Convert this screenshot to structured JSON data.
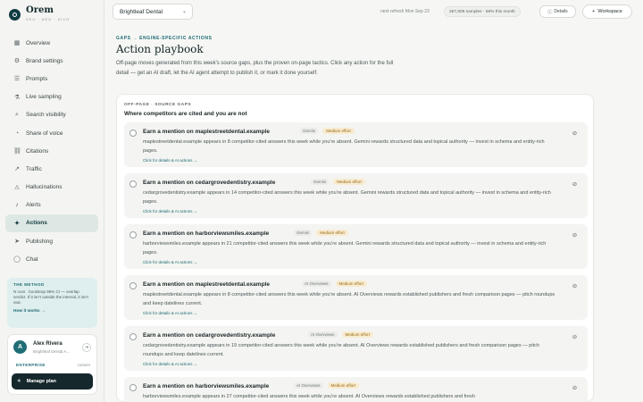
{
  "brand": {
    "name": "Orem",
    "tagline": "SEO · AEO · AIVO"
  },
  "sidebar": {
    "items": [
      {
        "label": "Overview",
        "icon": "grid-icon",
        "glyph": "▦"
      },
      {
        "label": "Brand settings",
        "icon": "gear-icon",
        "glyph": "⚙"
      },
      {
        "label": "Prompts",
        "icon": "list-icon",
        "glyph": "☰"
      },
      {
        "label": "Live sampling",
        "icon": "flask-icon",
        "glyph": "⚗"
      },
      {
        "label": "Search visibility",
        "icon": "search-icon",
        "glyph": "⌕"
      },
      {
        "label": "Share of voice",
        "icon": "pie-icon",
        "glyph": "◔"
      },
      {
        "label": "Citations",
        "icon": "link-icon",
        "glyph": "⛓"
      },
      {
        "label": "Traffic",
        "icon": "trend-icon",
        "glyph": "↗"
      },
      {
        "label": "Hallucinations",
        "icon": "warning-icon",
        "glyph": "⚠"
      },
      {
        "label": "Alerts",
        "icon": "bell-icon",
        "glyph": "♪"
      },
      {
        "label": "Actions",
        "icon": "bulb-icon",
        "glyph": "✦"
      },
      {
        "label": "Publishing",
        "icon": "send-icon",
        "glyph": "➤"
      },
      {
        "label": "Chat",
        "icon": "chat-icon",
        "glyph": "◯"
      }
    ],
    "active_index": 10,
    "method": {
      "title": "THE METHOD",
      "body": "N runs · bootstrap 95% CI — overlap verdict. If it isn't outside the interval, it isn't real.",
      "link": "How it works →"
    },
    "user": {
      "initial": "A",
      "name": "Alex Rivera",
      "org": "Brightleaf Dental A...",
      "plan": "ENTERPRISE",
      "plan_mode": "custom",
      "manage_label": "Manage plan"
    }
  },
  "topbar": {
    "brand_select": "Brightleaf Dental",
    "next_refresh": "next refresh Mon Sep 23",
    "samples": "287,509 samples · 58% this month",
    "details_label": "Details",
    "workspace_label": "Workspace"
  },
  "main": {
    "eyebrow": "GAPS → ENGINE-SPECIFIC ACTIONS",
    "title": "Action playbook",
    "description": "Off-page moves generated from this week's source gaps, plus the proven on-page tactics. Click any action for the full detail — get an AI draft, let the AI agent attempt to publish it, or mark it done yourself.",
    "section_eyebrow": "OFF-PAGE · SOURCE GAPS",
    "section_title": "Where competitors are cited and you are not",
    "actions": [
      {
        "title": "Earn a mention on maplestreetdental.example",
        "engine": "Gemini",
        "effort": "Medium effort",
        "body": "maplestreetdental.example appears in 8 competitor-cited answers this week while you're absent. Gemini rewards structured data and topical authority — invest in schema and entity-rich pages.",
        "link": "Click for details & AI actions →"
      },
      {
        "title": "Earn a mention on cedargrovedentistry.example",
        "engine": "Gemini",
        "effort": "Medium effort",
        "body": "cedargrovedentistry.example appears in 14 competitor-cited answers this week while you're absent. Gemini rewards structured data and topical authority — invest in schema and entity-rich pages.",
        "link": "Click for details & AI actions →"
      },
      {
        "title": "Earn a mention on harborviewsmiles.example",
        "engine": "Gemini",
        "effort": "Medium effort",
        "body": "harborviewsmiles.example appears in 21 competitor-cited answers this week while you're absent. Gemini rewards structured data and topical authority — invest in schema and entity-rich pages.",
        "link": "Click for details & AI actions →"
      },
      {
        "title": "Earn a mention on maplestreetdental.example",
        "engine": "AI Overviews",
        "effort": "Medium effort",
        "body": "maplestreetdental.example appears in 8 competitor-cited answers this week while you're absent. AI Overviews rewards established publishers and fresh comparison pages — pitch roundups and keep datelines current.",
        "link": "Click for details & AI actions →"
      },
      {
        "title": "Earn a mention on cedargrovedentistry.example",
        "engine": "AI Overviews",
        "effort": "Medium effort",
        "body": "cedargrovedentistry.example appears in 19 competitor-cited answers this week while you're absent. AI Overviews rewards established publishers and fresh comparison pages — pitch roundups and keep datelines current.",
        "link": "Click for details & AI actions →"
      },
      {
        "title": "Earn a mention on harborviewsmiles.example",
        "engine": "AI Overviews",
        "effort": "Medium effort",
        "body": "harborviewsmiles.example appears in 27 competitor-cited answers this week while you're absent. AI Overviews rewards established publishers and fresh",
        "link": ""
      }
    ]
  },
  "colors": {
    "accent": "#1d6a73",
    "active_bg": "#dde8e5",
    "effort_bg": "#f8ebd0",
    "effort_text": "#9a6a14"
  }
}
